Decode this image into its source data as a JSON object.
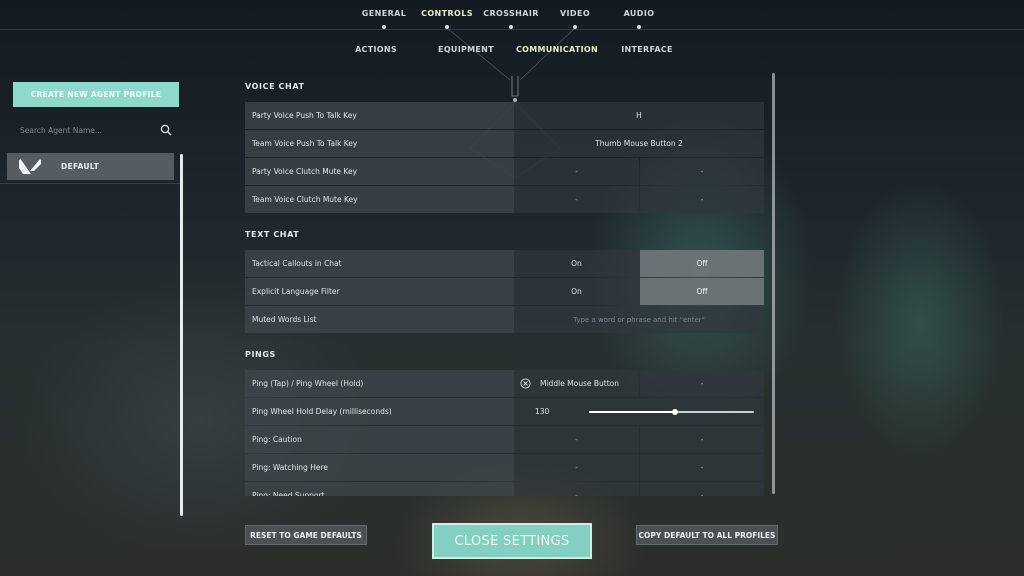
{
  "top_tabs": [
    {
      "label": "GENERAL"
    },
    {
      "label": "CONTROLS"
    },
    {
      "label": "CROSSHAIR"
    },
    {
      "label": "VIDEO"
    },
    {
      "label": "AUDIO"
    }
  ],
  "active_top_tab": "CONTROLS",
  "sub_tabs": [
    {
      "label": "ACTIONS"
    },
    {
      "label": "EQUIPMENT"
    },
    {
      "label": "COMMUNICATION"
    },
    {
      "label": "INTERFACE"
    }
  ],
  "active_sub_tab": "COMMUNICATION",
  "profiles": {
    "create_label": "CREATE NEW AGENT PROFILE",
    "search_placeholder": "Search Agent Name...",
    "items": [
      {
        "label": "DEFAULT"
      }
    ]
  },
  "voice_chat": {
    "title": "VOICE CHAT",
    "rows": [
      {
        "label": "Party Voice Push To Talk Key",
        "value": "H"
      },
      {
        "label": "Team Voice Push To Talk Key",
        "value": "Thumb Mouse Button 2"
      },
      {
        "label": "Party Voice Clutch Mute Key",
        "primary": "-",
        "secondary": "-"
      },
      {
        "label": "Team Voice Clutch Mute Key",
        "primary": "-",
        "secondary": "-"
      }
    ]
  },
  "text_chat": {
    "title": "TEXT CHAT",
    "rows": [
      {
        "label": "Tactical Callouts in Chat",
        "on": "On",
        "off": "Off",
        "selected": "Off"
      },
      {
        "label": "Explicit Language Filter",
        "on": "On",
        "off": "Off",
        "selected": "Off"
      }
    ],
    "muted_words": {
      "label": "Muted Words List",
      "placeholder": "Type a word or phrase and hit \"enter\""
    }
  },
  "pings": {
    "title": "PINGS",
    "ping_wheel": {
      "label": "Ping (Tap) / Ping Wheel (Hold)",
      "primary": "Middle Mouse Button",
      "secondary": "-"
    },
    "hold_delay": {
      "label": "Ping Wheel Hold Delay (milliseconds)",
      "value": "130",
      "fraction": 0.52
    },
    "rows": [
      {
        "label": "Ping: Caution",
        "primary": "-",
        "secondary": "-"
      },
      {
        "label": "Ping: Watching Here",
        "primary": "-",
        "secondary": "-"
      },
      {
        "label": "Ping: Need Support",
        "primary": "-",
        "secondary": "-"
      }
    ]
  },
  "footer": {
    "reset_label": "RESET TO GAME DEFAULTS",
    "close_label": "CLOSE SETTINGS",
    "copy_label": "COPY DEFAULT TO ALL PROFILES"
  },
  "colors": {
    "accent": "#8fd9cc",
    "active_tab": "#e9f0c8",
    "selected_cell": "#70787a"
  }
}
